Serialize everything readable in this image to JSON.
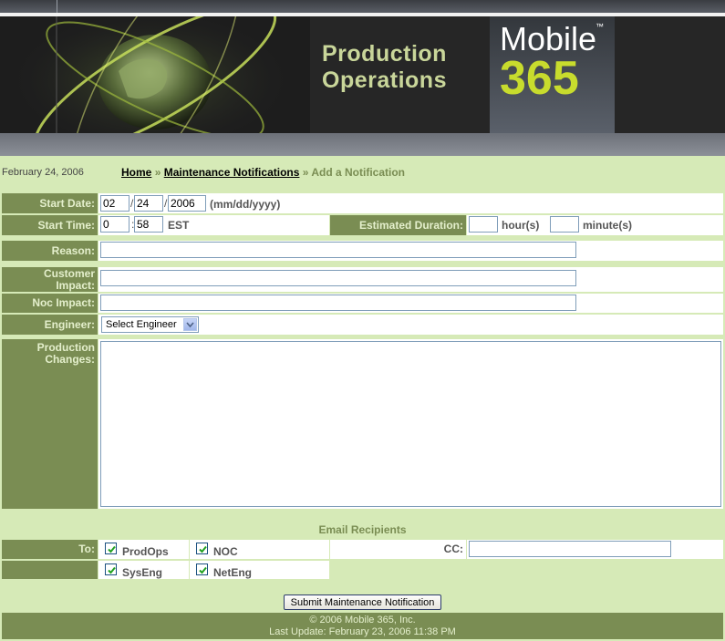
{
  "header": {
    "title_line1": "Production",
    "title_line2": "Operations",
    "logo_text": "Mobile",
    "logo_tm": "™",
    "logo_number": "365"
  },
  "breadcrumb": {
    "date": "February 24, 2006",
    "home": "Home",
    "sep1": "»",
    "maintenance": "Maintenance Notifications",
    "sep2": "»",
    "current": "Add a Notification"
  },
  "form": {
    "start_date_label": "Start Date:",
    "month": "02",
    "day": "24",
    "year": "2006",
    "date_sep": "/",
    "date_format": "(mm/dd/yyyy)",
    "start_time_label": "Start Time:",
    "hour": "0",
    "minute": "58",
    "time_sep": ":",
    "timezone": "EST",
    "duration_label": "Estimated Duration:",
    "duration_hours": "",
    "hours_unit": "hour(s)",
    "duration_minutes": "",
    "minutes_unit": "minute(s)",
    "reason_label": "Reason:",
    "reason": "",
    "customer_impact_label1": "Customer",
    "customer_impact_label2": "Impact:",
    "customer_impact": "",
    "noc_impact_label": "Noc Impact:",
    "noc_impact": "",
    "engineer_label": "Engineer:",
    "engineer_selected": "Select Engineer",
    "production_changes_label1": "Production",
    "production_changes_label2": "Changes:",
    "production_changes": "",
    "email_recipients_label": "Email Recipients",
    "to_label": "To:",
    "recipients": {
      "prodops": "ProdOps",
      "noc": "NOC",
      "syseng": "SysEng",
      "neteng": "NetEng"
    },
    "cc_label": "CC:",
    "cc": "",
    "submit_label": "Submit Maintenance Notification"
  },
  "footer": {
    "copyright": "© 2006 Mobile 365, Inc.",
    "last_update": "Last Update: February 23, 2006 11:38 PM"
  },
  "colors": {
    "label_bg": "#7a8d53",
    "label_text": "#e4efcc",
    "light_green": "#d6eab7",
    "header_dark": "#262626",
    "logo_yellow": "#c8dc2d"
  }
}
